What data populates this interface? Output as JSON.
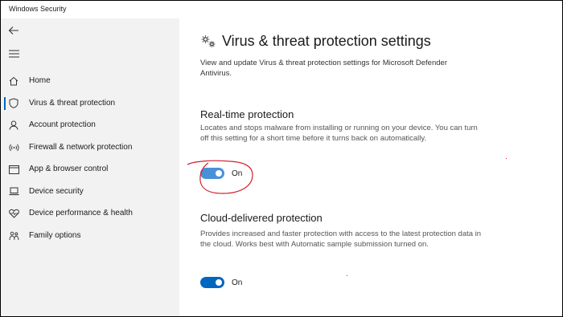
{
  "window": {
    "title": "Windows Security"
  },
  "sidebar": {
    "back_icon": "back-arrow-icon",
    "menu_icon": "hamburger-menu-icon",
    "items": [
      {
        "label": "Home",
        "icon": "home-icon"
      },
      {
        "label": "Virus & threat protection",
        "icon": "shield-icon",
        "selected": true
      },
      {
        "label": "Account protection",
        "icon": "person-icon"
      },
      {
        "label": "Firewall & network protection",
        "icon": "wireless-signal-icon"
      },
      {
        "label": "App & browser control",
        "icon": "browser-window-icon"
      },
      {
        "label": "Device security",
        "icon": "laptop-icon"
      },
      {
        "label": "Device performance & health",
        "icon": "heart-pulse-icon"
      },
      {
        "label": "Family options",
        "icon": "family-icon"
      }
    ]
  },
  "main": {
    "title": "Virus & threat protection settings",
    "title_icon": "gears-icon",
    "intro": "View and update Virus & threat protection settings for Microsoft Defender Antivirus.",
    "sections": [
      {
        "title": "Real-time protection",
        "description": "Locates and stops malware from installing or running on your device. You can turn off this setting for a short time before it turns back on automatically.",
        "toggle_state": "On",
        "toggle_on": true,
        "circled": true
      },
      {
        "title": "Cloud-delivered protection",
        "description": "Provides increased and faster protection with access to the latest protection data in the cloud. Works best with Automatic sample submission turned on.",
        "toggle_state": "On",
        "toggle_on": true,
        "circled": false
      }
    ]
  },
  "colors": {
    "accent": "#0067c0",
    "toggle_realtime": "#4a90d9",
    "toggle_cloud": "#0067c0",
    "annotation": "#d0202a",
    "sidebar_bg": "#f2f2f2"
  }
}
